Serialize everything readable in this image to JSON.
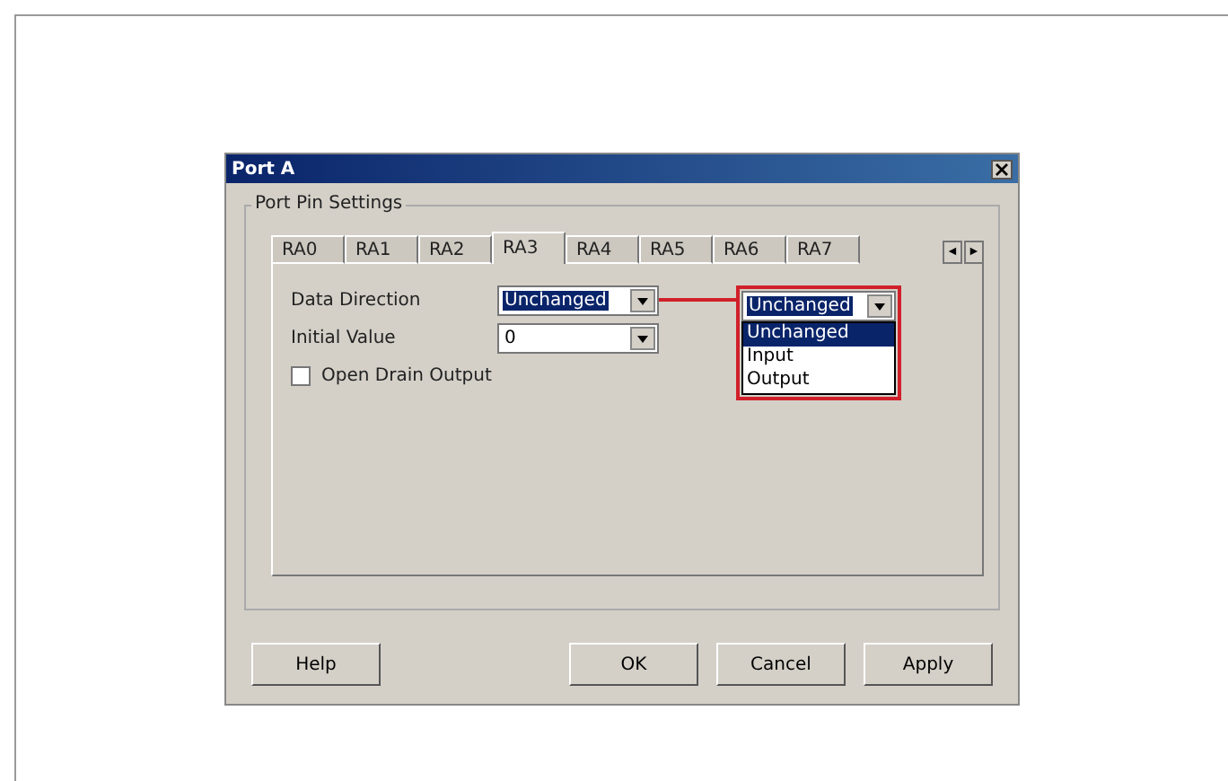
{
  "window": {
    "title": "Port A"
  },
  "group": {
    "title": "Port Pin Settings"
  },
  "tabs": [
    {
      "label": "RA0",
      "selected": false
    },
    {
      "label": "RA1",
      "selected": false
    },
    {
      "label": "RA2",
      "selected": false
    },
    {
      "label": "RA3",
      "selected": true
    },
    {
      "label": "RA4",
      "selected": false
    },
    {
      "label": "RA5",
      "selected": false
    },
    {
      "label": "RA6",
      "selected": false
    },
    {
      "label": "RA7",
      "selected": false
    }
  ],
  "tab_scroll": [
    "◄",
    "►"
  ],
  "fields": [
    {
      "kind": "combo",
      "label": "Data Direction",
      "value": "Unchanged",
      "highlighted": true
    },
    {
      "kind": "combo",
      "label": "Initial Value",
      "value": "0",
      "highlighted": false
    },
    {
      "kind": "checkbox",
      "label": "Open Drain Output",
      "checked": false
    }
  ],
  "callout": {
    "value": "Unchanged",
    "options": [
      {
        "label": "Unchanged",
        "selected": true
      },
      {
        "label": "Input",
        "selected": false
      },
      {
        "label": "Output",
        "selected": false
      }
    ]
  },
  "help_button": "Help",
  "buttons": [
    "OK",
    "Cancel",
    "Apply"
  ]
}
